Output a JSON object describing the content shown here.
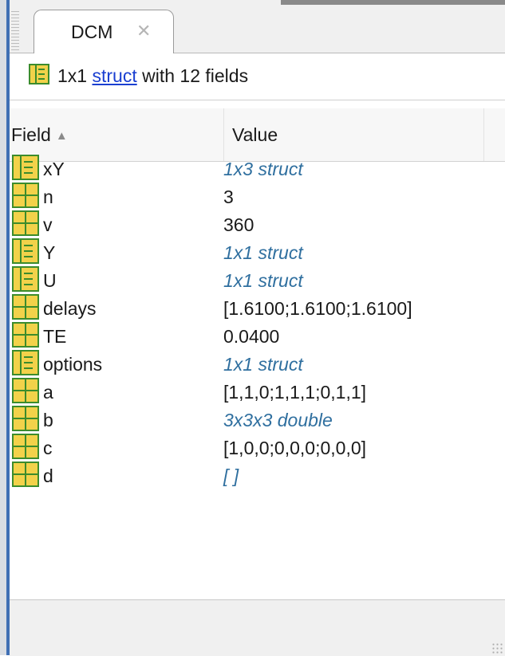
{
  "tab": {
    "title": "DCM",
    "close_glyph": "✕"
  },
  "summary": {
    "prefix": "1x1 ",
    "link": "struct",
    "suffix": " with 12 fields"
  },
  "columns": {
    "field": "Field",
    "value": "Value"
  },
  "icons": {
    "struct": "struct-icon",
    "matrix": "matrix-icon"
  },
  "colors": {
    "accent_edge": "#3f6fb4",
    "italic_value": "#2f6f9f",
    "link": "#1a3fd1",
    "icon_fill": "#f2d24a",
    "icon_stroke": "#3c8c2c"
  },
  "rows": [
    {
      "name": "xY",
      "value": "1x3 struct",
      "italic": true,
      "icon": "struct"
    },
    {
      "name": "n",
      "value": "3",
      "italic": false,
      "icon": "matrix"
    },
    {
      "name": "v",
      "value": "360",
      "italic": false,
      "icon": "matrix"
    },
    {
      "name": "Y",
      "value": "1x1 struct",
      "italic": true,
      "icon": "struct"
    },
    {
      "name": "U",
      "value": "1x1 struct",
      "italic": true,
      "icon": "struct"
    },
    {
      "name": "delays",
      "value": "[1.6100;1.6100;1.6100]",
      "italic": false,
      "icon": "matrix"
    },
    {
      "name": "TE",
      "value": "0.0400",
      "italic": false,
      "icon": "matrix"
    },
    {
      "name": "options",
      "value": "1x1 struct",
      "italic": true,
      "icon": "struct"
    },
    {
      "name": "a",
      "value": "[1,1,0;1,1,1;0,1,1]",
      "italic": false,
      "icon": "matrix"
    },
    {
      "name": "b",
      "value": "3x3x3 double",
      "italic": true,
      "icon": "matrix"
    },
    {
      "name": "c",
      "value": "[1,0,0;0,0,0;0,0,0]",
      "italic": false,
      "icon": "matrix"
    },
    {
      "name": "d",
      "value": "[ ]",
      "italic": true,
      "icon": "matrix"
    }
  ]
}
